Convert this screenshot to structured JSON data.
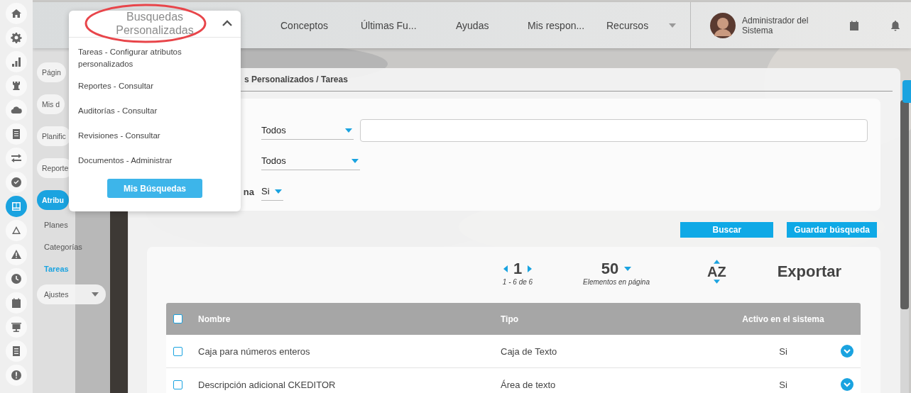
{
  "rail": [
    {
      "kind": "home",
      "selected": false
    },
    {
      "kind": "gear",
      "selected": false
    },
    {
      "kind": "bars",
      "selected": false
    },
    {
      "kind": "rook",
      "selected": false
    },
    {
      "kind": "cloud",
      "selected": false
    },
    {
      "kind": "doc",
      "selected": false
    },
    {
      "kind": "arrows",
      "selected": false
    },
    {
      "kind": "check",
      "selected": false
    },
    {
      "kind": "board",
      "selected": true
    },
    {
      "kind": "network",
      "selected": false
    },
    {
      "kind": "warning",
      "selected": false
    },
    {
      "kind": "clock",
      "selected": false
    },
    {
      "kind": "calendar",
      "selected": false
    },
    {
      "kind": "presentation",
      "selected": false
    },
    {
      "kind": "list",
      "selected": false
    },
    {
      "kind": "exclamation",
      "selected": false
    }
  ],
  "topbar": {
    "nav": [
      "Conceptos",
      "Últimas Fu...",
      "Ayudas",
      "Mis respon...",
      "Recursos"
    ],
    "user": "Administrador del Sistema"
  },
  "sidebar": {
    "items": [
      {
        "label": "Págin",
        "kind": "link",
        "selected": false
      },
      {
        "label": "Mis d",
        "kind": "link",
        "selected": false
      },
      {
        "label": "Planific",
        "kind": "link",
        "selected": false
      },
      {
        "label": "Reporte",
        "kind": "link",
        "selected": false
      },
      {
        "label": "Atribu",
        "kind": "link",
        "selected": true,
        "children": [
          {
            "label": "Planes",
            "selected": false
          },
          {
            "label": "Categorías",
            "selected": false
          },
          {
            "label": "Tareas",
            "selected": true
          }
        ]
      },
      {
        "label": "Ajustes",
        "kind": "menu",
        "selected": false
      }
    ]
  },
  "dropdown": {
    "title": "Busquedas Personalizadas",
    "expanded": true,
    "items": [
      "Tareas - Configurar atributos personalizados",
      "Reportes - Consultar",
      "Auditorías - Consultar",
      "Revisiones - Consultar",
      "Documentos - Administrar"
    ],
    "button": "Mis Búsquedas"
  },
  "breadcrumb": "s Personalizados / Tareas",
  "filters": [
    {
      "kind": "select_search",
      "value": "Todos"
    },
    {
      "kind": "select",
      "value": "Todos"
    },
    {
      "kind": "small_select",
      "label": "na",
      "value": "Si"
    }
  ],
  "buttons": [
    "Buscar",
    "Guardar búsqueda"
  ],
  "pager": {
    "page": "1",
    "range": "1 - 6 de 6",
    "page_size": "50",
    "page_size_label": "Elementos en página",
    "sort": "AZ",
    "export": "Exportar"
  },
  "table": {
    "columns": [
      "Nombre",
      "Tipo",
      "Activo en el sistema"
    ],
    "all_checked": false,
    "rows": [
      {
        "name": "Caja para números enteros",
        "type": "Caja de Texto",
        "active": "Si",
        "checked": false
      },
      {
        "name": "Descripción adicional CKEDITOR",
        "type": "Área de texto",
        "active": "Si",
        "checked": false
      }
    ]
  }
}
